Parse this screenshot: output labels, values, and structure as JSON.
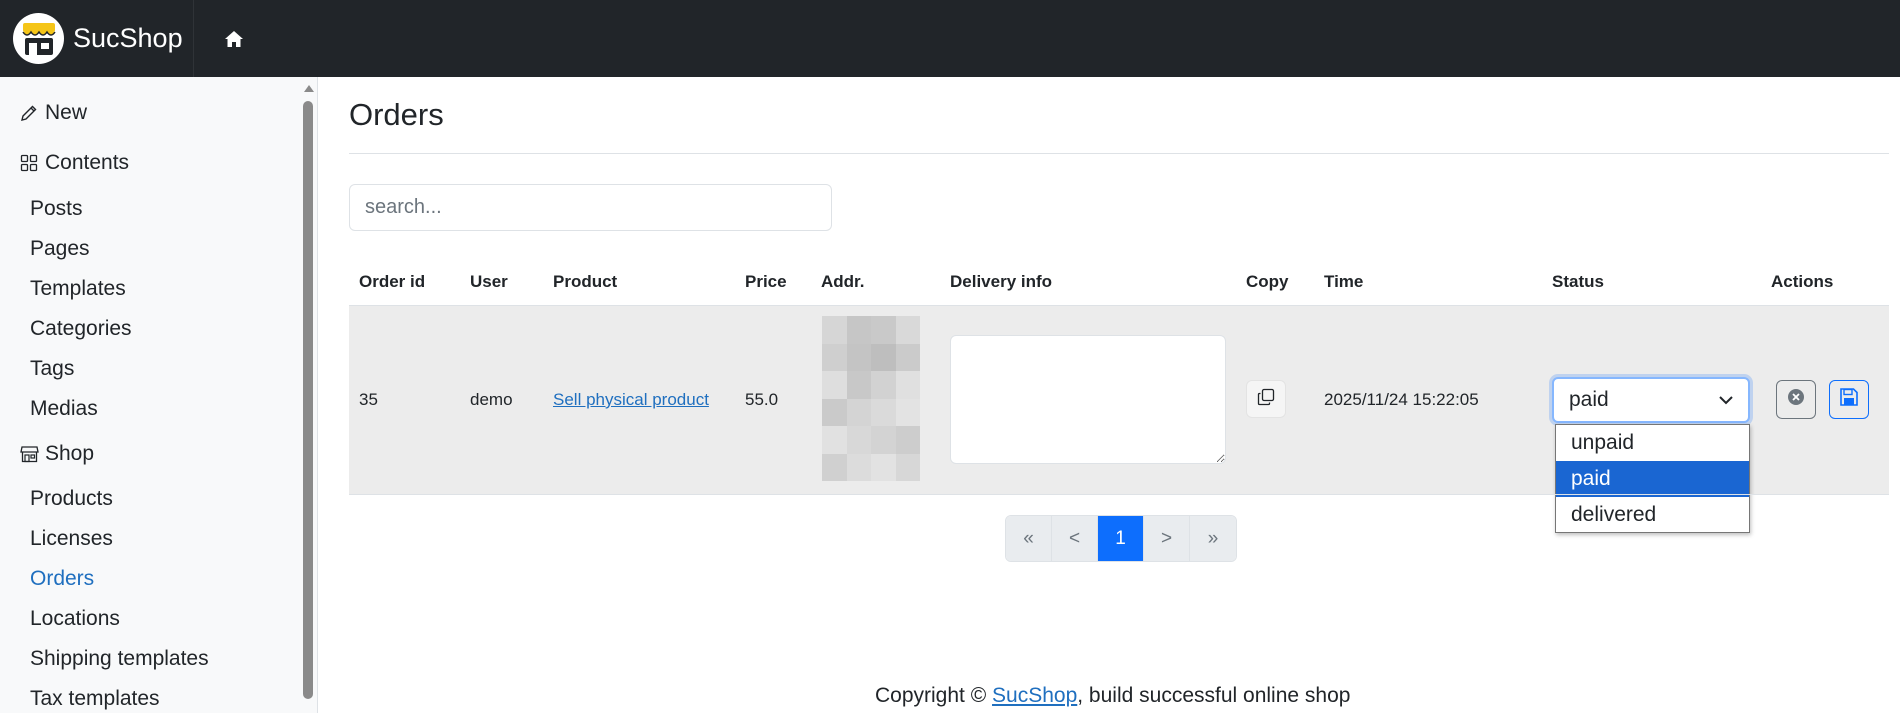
{
  "navbar": {
    "brand": "SucShop",
    "logo_icon": "shop-awning-icon",
    "home_icon": "home-icon",
    "colors": {
      "background": "#212529",
      "logo_awning": "#f5c518"
    }
  },
  "sidebar": {
    "new_label": "New",
    "contents_label": "Contents",
    "contents_items": [
      "Posts",
      "Pages",
      "Templates",
      "Categories",
      "Tags",
      "Medias"
    ],
    "shop_label": "Shop",
    "shop_items": [
      "Products",
      "Licenses",
      "Orders",
      "Locations",
      "Shipping templates",
      "Tax templates"
    ],
    "active_item": "Orders",
    "icons": {
      "new": "pencil-icon",
      "contents": "grid-icon",
      "shop": "shop-icon"
    }
  },
  "main": {
    "title": "Orders",
    "search_placeholder": "search...",
    "columns": [
      "Order id",
      "User",
      "Product",
      "Price",
      "Addr.",
      "Delivery info",
      "Copy",
      "Time",
      "Status",
      "Actions"
    ],
    "rows": [
      {
        "order_id": "35",
        "user": "demo",
        "product": "Sell physical product",
        "price": "55.0",
        "delivery_info": "",
        "time": "2025/11/24 15:22:05",
        "status": "paid"
      }
    ],
    "status_options": [
      "unpaid",
      "paid",
      "delivered"
    ],
    "selected_status": "paid",
    "icons": {
      "copy": "copy-icon",
      "cancel": "x-circle-icon",
      "save": "floppy-disk-icon",
      "chevron": "chevron-down-icon"
    }
  },
  "pagination": {
    "first": "«",
    "prev": "<",
    "current": "1",
    "next": ">",
    "last": "»"
  },
  "footer": {
    "prefix": "Copyright © ",
    "link": "SucShop",
    "suffix": ", build successful online shop"
  },
  "colors": {
    "accent": "#0d6efd",
    "link": "#1f6fbf",
    "option_highlight": "#1a66d2",
    "row_background": "#ececec"
  }
}
